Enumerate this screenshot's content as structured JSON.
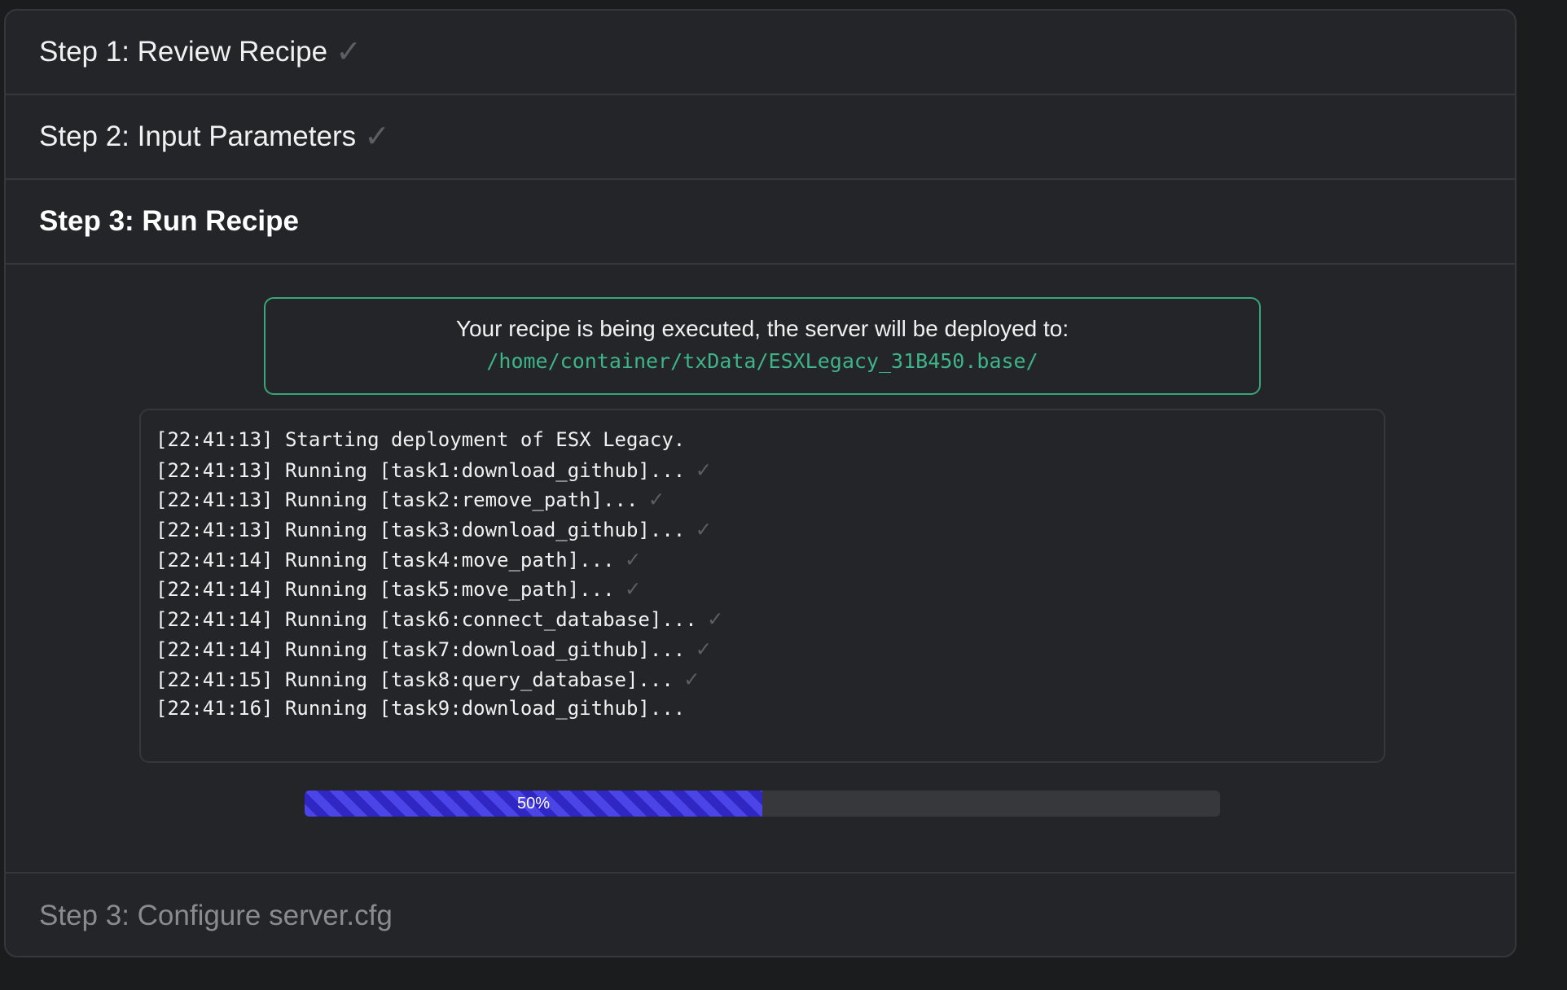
{
  "steps": {
    "step1": {
      "label": "Step 1: Review Recipe",
      "status": "complete"
    },
    "step2": {
      "label": "Step 2: Input Parameters",
      "status": "complete"
    },
    "step3": {
      "label": "Step 3: Run Recipe",
      "status": "active"
    },
    "step4": {
      "label": "Step 3: Configure server.cfg",
      "status": "disabled"
    }
  },
  "check_glyph": "✓",
  "notice": {
    "text": "Your recipe is being executed, the server will be deployed to:",
    "path": "/home/container/txData/ESXLegacy_31B450.base/"
  },
  "log": [
    {
      "text": "[22:41:13] Starting deployment of ESX Legacy.",
      "done": false
    },
    {
      "text": "[22:41:13] Running [task1:download_github]...",
      "done": true
    },
    {
      "text": "[22:41:13] Running [task2:remove_path]...",
      "done": true
    },
    {
      "text": "[22:41:13] Running [task3:download_github]...",
      "done": true
    },
    {
      "text": "[22:41:14] Running [task4:move_path]...",
      "done": true
    },
    {
      "text": "[22:41:14] Running [task5:move_path]...",
      "done": true
    },
    {
      "text": "[22:41:14] Running [task6:connect_database]...",
      "done": true
    },
    {
      "text": "[22:41:14] Running [task7:download_github]...",
      "done": true
    },
    {
      "text": "[22:41:15] Running [task8:query_database]...",
      "done": true
    },
    {
      "text": "[22:41:16] Running [task9:download_github]...",
      "done": false
    }
  ],
  "progress": {
    "value": 50,
    "label": "50%"
  },
  "colors": {
    "accent_green": "#3aa57a",
    "progress_blue": "#3d33d6",
    "check_gray": "#5d5e63"
  }
}
